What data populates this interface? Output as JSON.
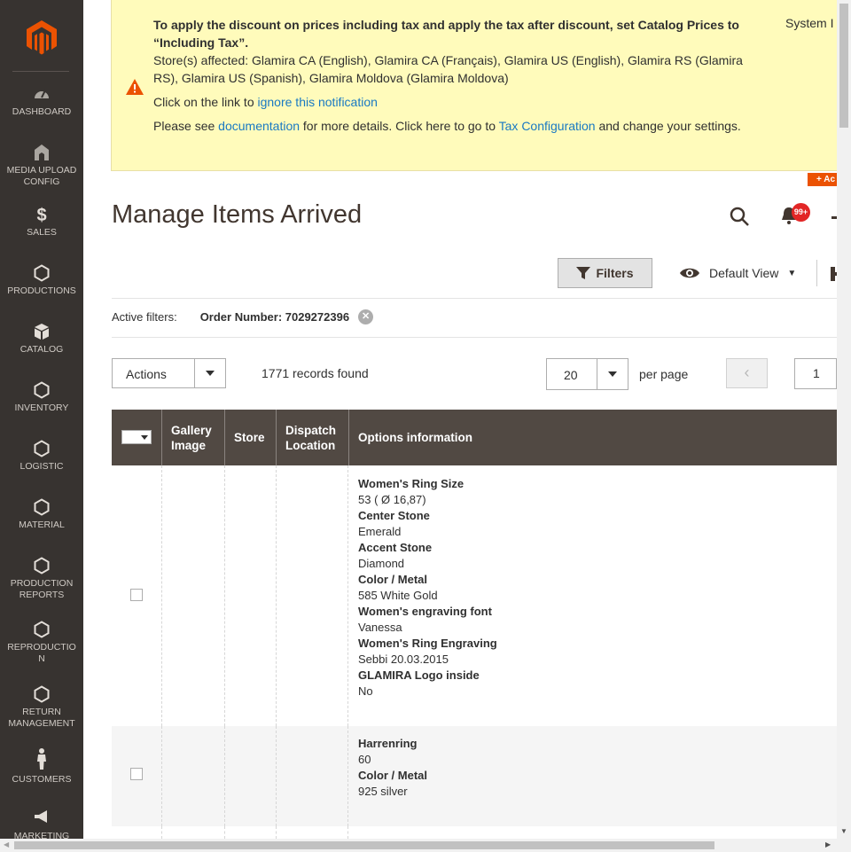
{
  "sidebar": {
    "items": [
      {
        "label": "DASHBOARD",
        "icon": "dashboard-icon"
      },
      {
        "label": "MEDIA UPLOAD CONFIG",
        "icon": "media-upload-icon"
      },
      {
        "label": "SALES",
        "icon": "dollar-icon"
      },
      {
        "label": "PRODUCTIONS",
        "icon": "hexagon-icon"
      },
      {
        "label": "CATALOG",
        "icon": "cube-icon"
      },
      {
        "label": "INVENTORY",
        "icon": "hexagon-icon"
      },
      {
        "label": "LOGISTIC",
        "icon": "hexagon-icon"
      },
      {
        "label": "MATERIAL",
        "icon": "hexagon-icon"
      },
      {
        "label": "PRODUCTION REPORTS",
        "icon": "hexagon-icon"
      },
      {
        "label": "REPRODUCTIO N",
        "icon": "hexagon-icon"
      },
      {
        "label": "RETURN MANAGEMENT",
        "icon": "hexagon-icon"
      },
      {
        "label": "CUSTOMERS",
        "icon": "person-icon"
      },
      {
        "label": "MARKETING",
        "icon": "megaphone-icon"
      }
    ]
  },
  "notice": {
    "heading": "To apply the discount on prices including tax and apply the tax after discount, set Catalog Prices to “Including Tax”.",
    "stores": "Store(s) affected: Glamira CA (English), Glamira CA (Français), Glamira US (English), Glamira RS (Glamira RS), Glamira US (Spanish), Glamira Moldova (Glamira Moldova)",
    "ignore_prefix": "Click on the link to ",
    "ignore_link": "ignore this notification",
    "see_prefix": "Please see ",
    "doc_link": "documentation",
    "see_middle": " for more details. Click here to go to ",
    "tax_link": "Tax Configuration",
    "see_suffix": " and change your settings.",
    "system_label": "System I"
  },
  "add_tag": "+ Ac",
  "header": {
    "title": "Manage Items Arrived",
    "notifications_count": "99+"
  },
  "toolbar": {
    "filters_label": "Filters",
    "view_label": "Default View",
    "active_filters_label": "Active filters:",
    "active_filter_value": "Order Number: 7029272396",
    "actions_label": "Actions",
    "records_found": "1771 records found",
    "per_page_value": "20",
    "per_page_label": "per page",
    "prev_label": "‹",
    "page_value": "1"
  },
  "grid": {
    "columns": [
      "Gallery Image",
      "Store",
      "Dispatch Location",
      "Options information"
    ],
    "rows": [
      {
        "options": [
          {
            "key": "Women's Ring Size",
            "value": "53 ( Ø 16,87)"
          },
          {
            "key": "Center Stone",
            "value": "Emerald"
          },
          {
            "key": "Accent Stone",
            "value": "Diamond"
          },
          {
            "key": "Color / Metal",
            "value": "585 White Gold"
          },
          {
            "key": "Women's engraving font",
            "value": "Vanessa"
          },
          {
            "key": "Women's Ring Engraving",
            "value": "Sebbi 20.03.2015"
          },
          {
            "key": "GLAMIRA Logo inside",
            "value": "No"
          }
        ]
      },
      {
        "options": [
          {
            "key": "Harrenring",
            "value": "60"
          },
          {
            "key": "Color / Metal",
            "value": "925 silver"
          }
        ]
      }
    ]
  },
  "colors": {
    "sidebar_bg": "#373330",
    "notice_bg": "#fffbbb",
    "grid_header_bg": "#514943",
    "link": "#1979c3",
    "accent": "#eb5202",
    "badge": "#e22626"
  }
}
